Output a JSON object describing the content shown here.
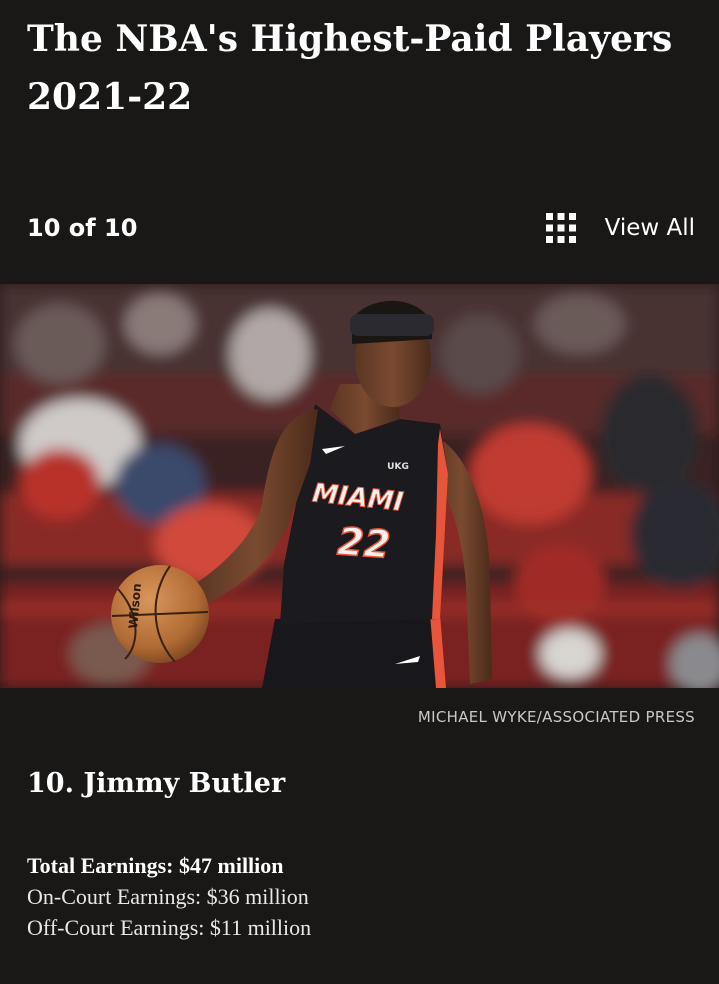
{
  "header": {
    "title": "The NBA's Highest-Paid Players 2021-22"
  },
  "nav": {
    "counter": "10 of 10",
    "view_all_label": "View All",
    "view_all_icon": "grid-icon"
  },
  "photo": {
    "jersey_team": "MIAMI",
    "jersey_number": "22",
    "jersey_sponsor": "UKG",
    "ball_brand": "Wilson",
    "credit": "MICHAEL WYKE/ASSOCIATED PRESS"
  },
  "slide": {
    "player_name": "10. Jimmy Butler",
    "total_earnings": "Total Earnings: $47 million",
    "on_court_earnings": "On-Court Earnings: $36 million",
    "off_court_earnings": "Off-Court Earnings: $11 million"
  },
  "colors": {
    "background": "#191817",
    "text": "#ffffff",
    "credit": "#c8c8c8",
    "jersey": "#1b1a1f",
    "jersey_accent": "#e8553a"
  }
}
